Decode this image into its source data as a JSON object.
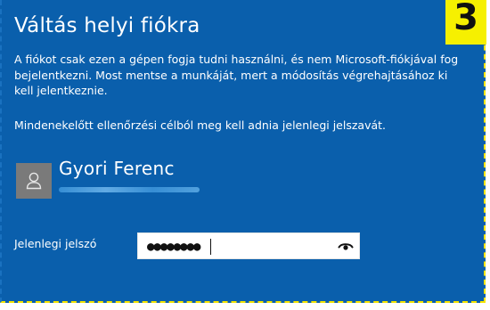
{
  "dialog": {
    "title": "Váltás helyi fiókra",
    "description": "A fiókot csak ezen a gépen fogja tudni használni, és nem Microsoft-fiókjával fog bejelentkezni. Most mentse a munkáját, mert a módosítás végrehajtásához ki kell jelentkeznie.",
    "verify_text": "Mindenekelőtt ellenőrzési célból meg kell adnia jelenlegi jelszavát.",
    "step_number": "3"
  },
  "user": {
    "name": "Gyori Ferenc",
    "avatar_icon": "person-icon"
  },
  "password": {
    "label": "Jelenlegi jelszó",
    "masked_value": "●●●●●●●●",
    "reveal_icon": "eye-icon"
  },
  "colors": {
    "background": "#0a5fac",
    "badge": "#f6f000",
    "text": "#ffffff"
  }
}
